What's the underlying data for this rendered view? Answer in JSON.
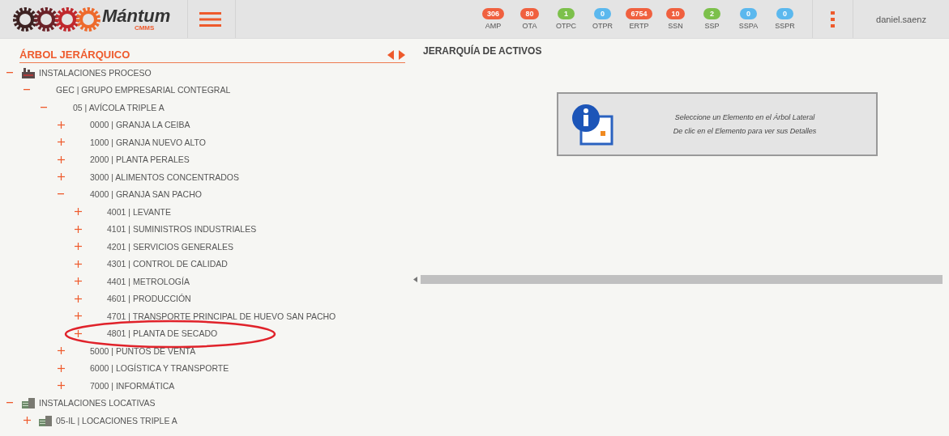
{
  "header": {
    "logo": {
      "name": "Mántum",
      "subtitle": "CMMS"
    },
    "counters": [
      {
        "count": "306",
        "label": "AMP",
        "color": "#f0603f"
      },
      {
        "count": "80",
        "label": "OTA",
        "color": "#f0603f"
      },
      {
        "count": "1",
        "label": "OTPC",
        "color": "#7cc04b"
      },
      {
        "count": "0",
        "label": "OTPR",
        "color": "#5bb8ee"
      },
      {
        "count": "6754",
        "label": "ERTP",
        "color": "#f0603f"
      },
      {
        "count": "10",
        "label": "SSN",
        "color": "#f0603f"
      },
      {
        "count": "2",
        "label": "SSP",
        "color": "#7cc04b"
      },
      {
        "count": "0",
        "label": "SSPA",
        "color": "#5bb8ee"
      },
      {
        "count": "0",
        "label": "SSPR",
        "color": "#5bb8ee"
      }
    ],
    "user": "daniel.saenz"
  },
  "sidebar": {
    "title": "ÁRBOL JERÁRQUICO",
    "tree": [
      {
        "label": "INSTALACIONES PROCESO",
        "kind": "factory",
        "expanded": true,
        "children": [
          {
            "label": "GEC | GRUPO EMPRESARIAL CONTEGRAL",
            "expanded": true,
            "children": [
              {
                "label": "05 | AVÍCOLA TRIPLE A",
                "expanded": true,
                "children": [
                  {
                    "label": "0000 | GRANJA LA CEIBA",
                    "expanded": false
                  },
                  {
                    "label": "1000 | GRANJA NUEVO ALTO",
                    "expanded": false
                  },
                  {
                    "label": "2000 | PLANTA PERALES",
                    "expanded": false
                  },
                  {
                    "label": "3000 | ALIMENTOS CONCENTRADOS",
                    "expanded": false
                  },
                  {
                    "label": "4000 | GRANJA SAN PACHO",
                    "expanded": true,
                    "children": [
                      {
                        "label": "4001 | LEVANTE",
                        "expanded": false
                      },
                      {
                        "label": "4101 | SUMINISTROS INDUSTRIALES",
                        "expanded": false
                      },
                      {
                        "label": "4201 | SERVICIOS GENERALES",
                        "expanded": false
                      },
                      {
                        "label": "4301 | CONTROL DE CALIDAD",
                        "expanded": false
                      },
                      {
                        "label": "4401 | METROLOGÍA",
                        "expanded": false
                      },
                      {
                        "label": "4601 | PRODUCCIÓN",
                        "expanded": false
                      },
                      {
                        "label": "4701 | TRANSPORTE PRINCIPAL DE HUEVO SAN PACHO",
                        "expanded": false
                      },
                      {
                        "label": "4801 | PLANTA DE SECADO",
                        "expanded": false,
                        "circled": true
                      }
                    ]
                  },
                  {
                    "label": "5000 | PUNTOS DE VENTA",
                    "expanded": false
                  },
                  {
                    "label": "6000 | LOGÍSTICA Y TRANSPORTE",
                    "expanded": false
                  },
                  {
                    "label": "7000 | INFORMÁTICA",
                    "expanded": false
                  }
                ]
              }
            ]
          }
        ]
      },
      {
        "label": "INSTALACIONES LOCATIVAS",
        "kind": "building",
        "expanded": true,
        "children": [
          {
            "label": "05-IL | LOCACIONES TRIPLE A",
            "kind": "building",
            "expanded": false
          }
        ]
      }
    ]
  },
  "main": {
    "title": "JERARQUÍA DE ACTIVOS",
    "message": {
      "line_1": "Seleccione un Elemento en el Árbol Lateral",
      "line_2": "De clic en el Elemento para ver sus Detalles"
    }
  }
}
